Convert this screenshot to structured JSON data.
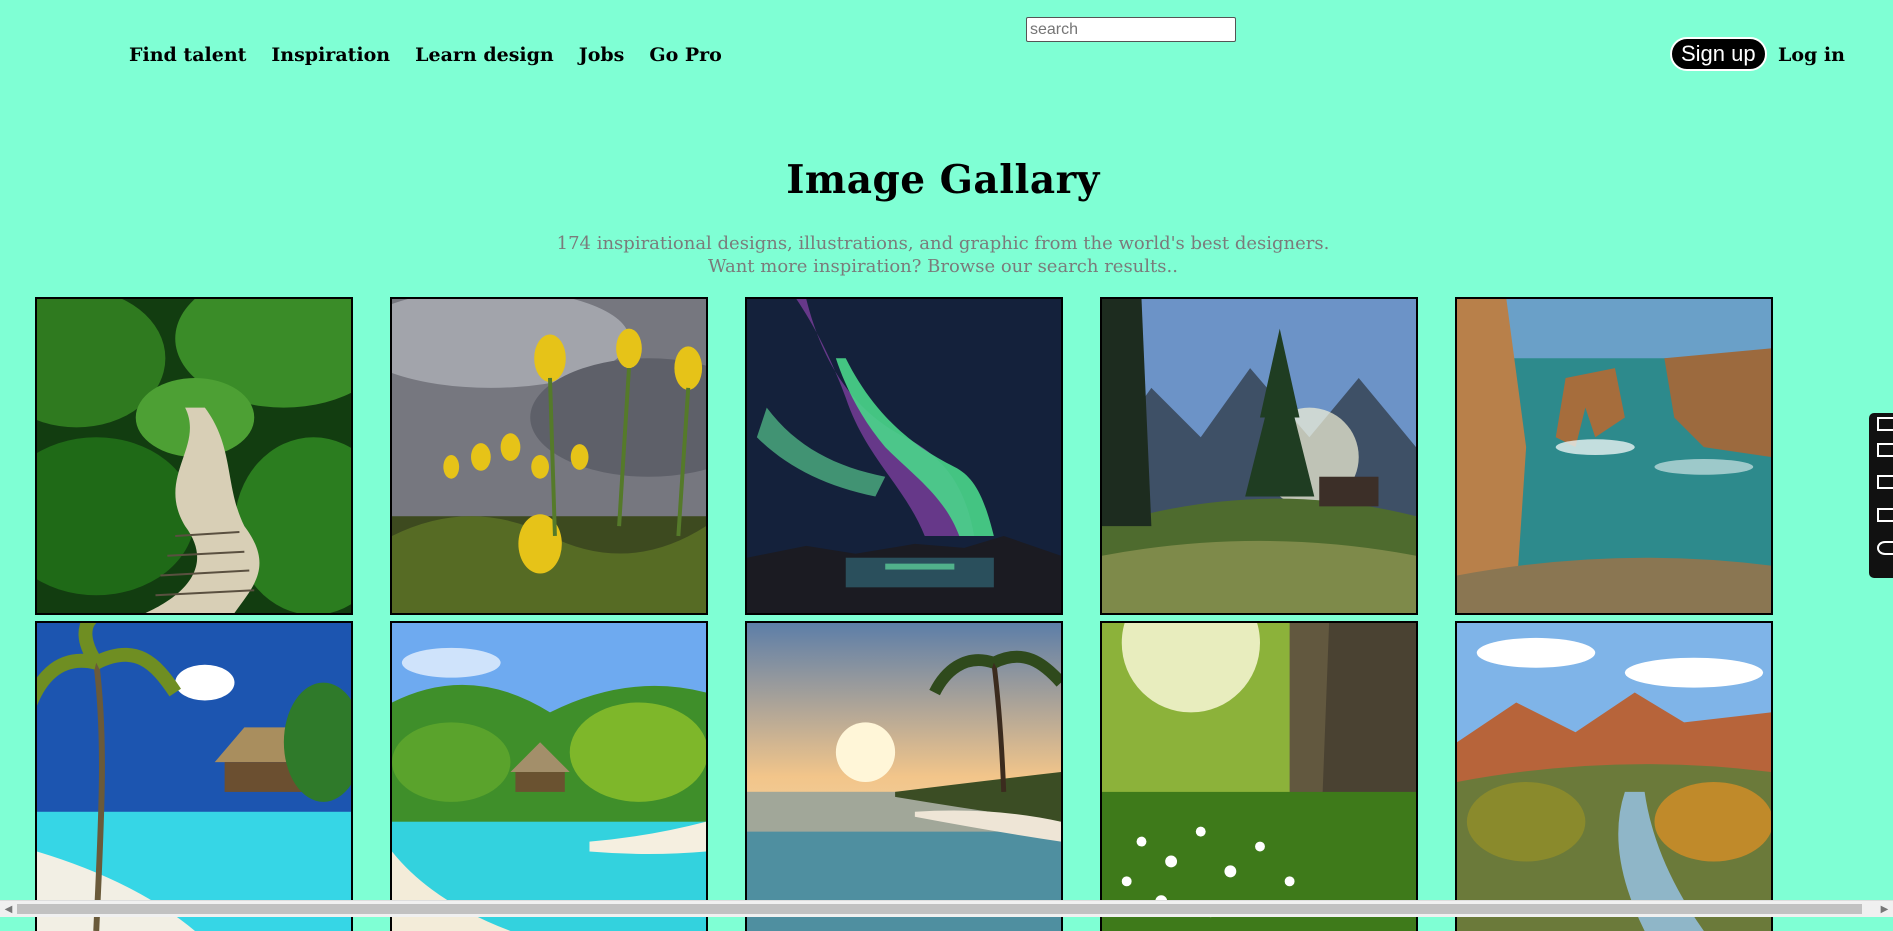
{
  "nav": {
    "items": [
      {
        "label": "Find talent"
      },
      {
        "label": "Inspiration"
      },
      {
        "label": "Learn design"
      },
      {
        "label": "Jobs"
      },
      {
        "label": "Go Pro"
      }
    ]
  },
  "search": {
    "placeholder": "search",
    "value": ""
  },
  "auth": {
    "signup_label": "Sign up",
    "login_label": "Log in"
  },
  "hero": {
    "title": "Image Gallary",
    "line1": "174 inspirational designs, illustrations, and graphic from the world's best designers.",
    "line2": "Want more inspiration? Browse our search results.."
  },
  "gallery": {
    "images": [
      {
        "name": "jungle-boardwalk"
      },
      {
        "name": "yellow-tulips"
      },
      {
        "name": "northern-lights"
      },
      {
        "name": "mountain-meadow-tree"
      },
      {
        "name": "sea-cliffs"
      },
      {
        "name": "tropical-beach-bungalows"
      },
      {
        "name": "lagoon-palm-island"
      },
      {
        "name": "sunset-beach-palms"
      },
      {
        "name": "sunlit-meadow-flowers"
      },
      {
        "name": "canyon-river"
      }
    ]
  },
  "icons": {
    "side_tools": [
      "settings-icon",
      "camera-icon",
      "window-icon",
      "screen-icon",
      "gear-icon"
    ]
  },
  "colors": {
    "background": "#7fffd4",
    "button": "#000000"
  }
}
